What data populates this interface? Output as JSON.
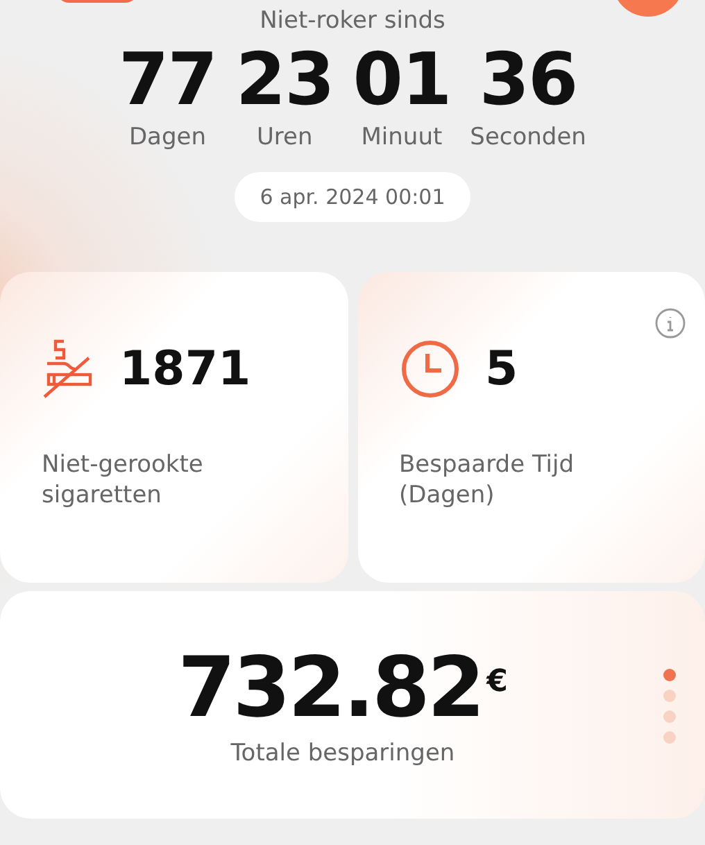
{
  "header": {
    "title": "Niet-roker sinds"
  },
  "counter": [
    {
      "value": "77",
      "unit": "Dagen"
    },
    {
      "value": "23",
      "unit": "Uren"
    },
    {
      "value": "01",
      "unit": "Minuut"
    },
    {
      "value": "36",
      "unit": "Seconden"
    }
  ],
  "start_date": "6 apr. 2024 00:01",
  "stats": [
    {
      "kind": "cigarette",
      "value": "1871",
      "label": "Niet-gerookte sigaretten",
      "info": false
    },
    {
      "kind": "clock",
      "value": "5",
      "label": "Bespaarde Tijd (Dagen)",
      "info": true
    }
  ],
  "savings": {
    "amount": "732.82",
    "currency": "€",
    "label": "Totale besparingen"
  },
  "pager": [
    {
      "selected": true
    },
    {
      "selected": false
    },
    {
      "selected": false
    },
    {
      "selected": false
    }
  ]
}
